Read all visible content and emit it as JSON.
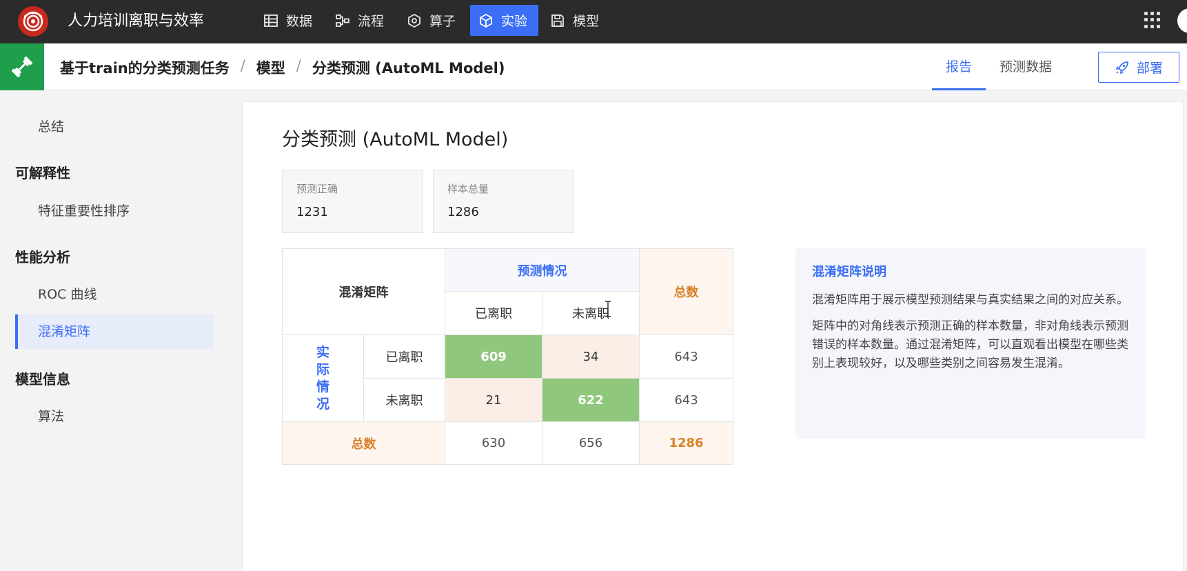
{
  "app": {
    "title": "人力培训离职与效率",
    "nav": [
      {
        "label": "数据",
        "icon": "table-icon",
        "active": false
      },
      {
        "label": "流程",
        "icon": "flow-icon",
        "active": false
      },
      {
        "label": "算子",
        "icon": "operator-icon",
        "active": false
      },
      {
        "label": "实验",
        "icon": "cube-icon",
        "active": true
      },
      {
        "label": "模型",
        "icon": "save-icon",
        "active": false
      }
    ]
  },
  "breadcrumb": {
    "items": [
      "基于train的分类预测任务",
      "模型",
      "分类预测 (AutoML Model)"
    ],
    "separator": "/"
  },
  "subtabs": [
    {
      "label": "报告",
      "active": true
    },
    {
      "label": "预测数据",
      "active": false
    }
  ],
  "deploy_label": "部署",
  "sidebar": {
    "summary": "总结",
    "section_explain": "可解释性",
    "feature_importance": "特征重要性排序",
    "section_perf": "性能分析",
    "roc": "ROC 曲线",
    "confusion": "混淆矩阵",
    "section_model": "模型信息",
    "algorithm": "算法"
  },
  "main": {
    "title": "分类预测 (AutoML Model)",
    "stats": [
      {
        "label": "预测正确",
        "value": "1231"
      },
      {
        "label": "样本总量",
        "value": "1286"
      }
    ]
  },
  "matrix": {
    "corner": "混淆矩阵",
    "predicted_header": "预测情况",
    "total_header": "总数",
    "actual_header": "实际情况",
    "classes": [
      "已离职",
      "未离职"
    ],
    "rows": [
      {
        "label": "已离职",
        "cells": [
          "609",
          "34"
        ],
        "total": "643"
      },
      {
        "label": "未离职",
        "cells": [
          "21",
          "622"
        ],
        "total": "643"
      }
    ],
    "column_totals": [
      "630",
      "656"
    ],
    "grand_total": "1286"
  },
  "explain": {
    "title": "混淆矩阵说明",
    "p1": "混淆矩阵用于展示模型预测结果与真实结果之间的对应关系。",
    "p2": "矩阵中的对角线表示预测正确的样本数量，非对角线表示预测错误的样本数量。通过混淆矩阵，可以直观看出模型在哪些类别上表现较好，以及哪些类别之间容易发生混淆。"
  },
  "colors": {
    "accent": "#3b6ef5",
    "correct": "#8fc77c",
    "total": "#d9822b",
    "topbar": "#2b2b2b",
    "brand_green": "#1f9e4b"
  }
}
